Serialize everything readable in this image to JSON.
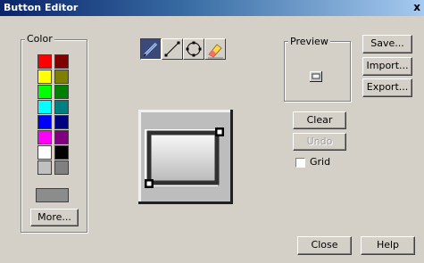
{
  "window": {
    "title": "Button Editor",
    "close_glyph": "x"
  },
  "color_group": {
    "label": "Color",
    "swatches": [
      "#ff0000",
      "#800000",
      "#ffff00",
      "#808000",
      "#00ff00",
      "#008000",
      "#00ffff",
      "#008080",
      "#0000ff",
      "#000080",
      "#ff00ff",
      "#800080",
      "#ffffff",
      "#000000",
      "#c0c0c0",
      "#808080"
    ],
    "current_color": "#8c8c8c",
    "more_label": "More..."
  },
  "tools": [
    {
      "name": "pencil-tool",
      "active": true
    },
    {
      "name": "line-tool",
      "active": false
    },
    {
      "name": "ellipse-tool",
      "active": false
    },
    {
      "name": "eraser-tool",
      "active": false
    }
  ],
  "preview": {
    "label": "Preview"
  },
  "buttons": {
    "save": "Save...",
    "import": "Import...",
    "export": "Export...",
    "clear": "Clear",
    "undo": "Undo",
    "close": "Close",
    "help": "Help"
  },
  "grid": {
    "label": "Grid",
    "checked": false
  }
}
